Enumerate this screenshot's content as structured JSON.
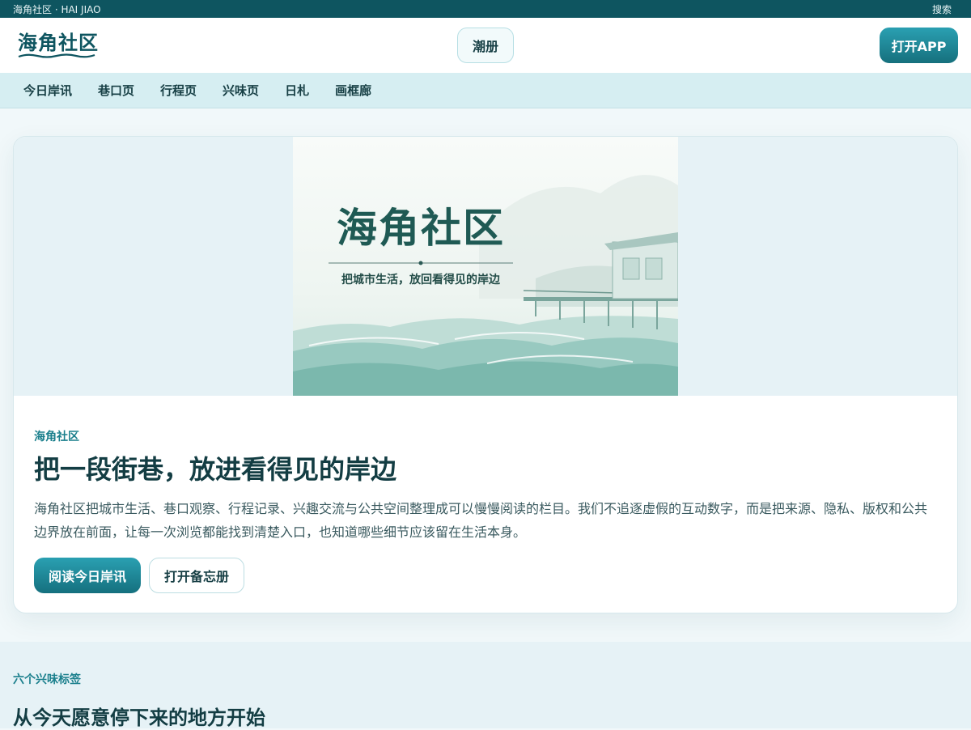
{
  "topbar": {
    "site": "海角社区 · HAI JIAO",
    "search": "搜索"
  },
  "header": {
    "logo": "海角社区",
    "center_button": "潮册",
    "app_button": "打开APP"
  },
  "nav": {
    "items": [
      "今日岸讯",
      "巷口页",
      "行程页",
      "兴味页",
      "日札",
      "画框廊"
    ]
  },
  "hero": {
    "banner_title": "海角社区",
    "banner_subtitle": "把城市生活，放回看得见的岸边",
    "kicker": "海角社区",
    "headline": "把一段街巷，放进看得见的岸边",
    "description": "海角社区把城市生活、巷口观察、行程记录、兴趣交流与公共空间整理成可以慢慢阅读的栏目。我们不追逐虚假的互动数字，而是把来源、隐私、版权和公共边界放在前面，让每一次浏览都能找到清楚入口，也知道哪些细节应该留在生活本身。",
    "primary_button": "阅读今日岸讯",
    "secondary_button": "打开备忘册"
  },
  "section": {
    "kicker": "六个兴味标签",
    "title": "从今天愿意停下来的地方开始"
  },
  "colors": {
    "brand": "#0e5560",
    "accent": "#1f9aaa",
    "nav_bg": "#d6eef2"
  }
}
